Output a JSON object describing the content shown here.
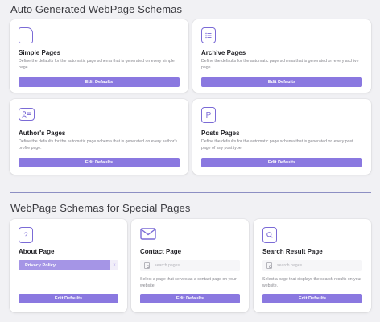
{
  "section_auto": {
    "title": "Auto Generated WebPage Schemas"
  },
  "section_special": {
    "title": "WebPage Schemas for Special Pages"
  },
  "auto_cards": [
    {
      "icon": "document-icon",
      "title": "Simple Pages",
      "desc": "Define the defaults for the automatic page schema that is generated on every simple page.",
      "button": "Edit Defaults"
    },
    {
      "icon": "list-icon",
      "title": "Archive Pages",
      "desc": "Define the defaults for the automatic page schema that is generated on every archive page.",
      "button": "Edit Defaults"
    },
    {
      "icon": "profile-card-icon",
      "title": "Author's Pages",
      "desc": "Define the defaults for the automatic page schema that is generated on every author's profile page.",
      "button": "Edit Defaults"
    },
    {
      "icon": "letter-p-icon",
      "title": "Posts Pages",
      "desc": "Define the defaults for the automatic page schema that is generated on every post page of any post type.",
      "button": "Edit Defaults"
    }
  ],
  "special_cards": [
    {
      "icon": "question-mark-icon",
      "title": "About Page",
      "selected": "Privacy Policy",
      "remove": "×",
      "button": "Edit Defaults"
    },
    {
      "icon": "envelope-icon",
      "title": "Contact Page",
      "search_placeholder": "search pages...",
      "desc": "Select a page that serves as a contact page on your website.",
      "button": "Edit Defaults"
    },
    {
      "icon": "search-icon",
      "title": "Search Result Page",
      "search_placeholder": "search pages...",
      "desc": "Select a page that displays the search results on your website.",
      "button": "Edit Defaults"
    }
  ],
  "colors": {
    "accent": "#8a78e0",
    "icon": "#7b6bd6",
    "divider": "#8d8fc3",
    "background": "#f1f1f4"
  }
}
